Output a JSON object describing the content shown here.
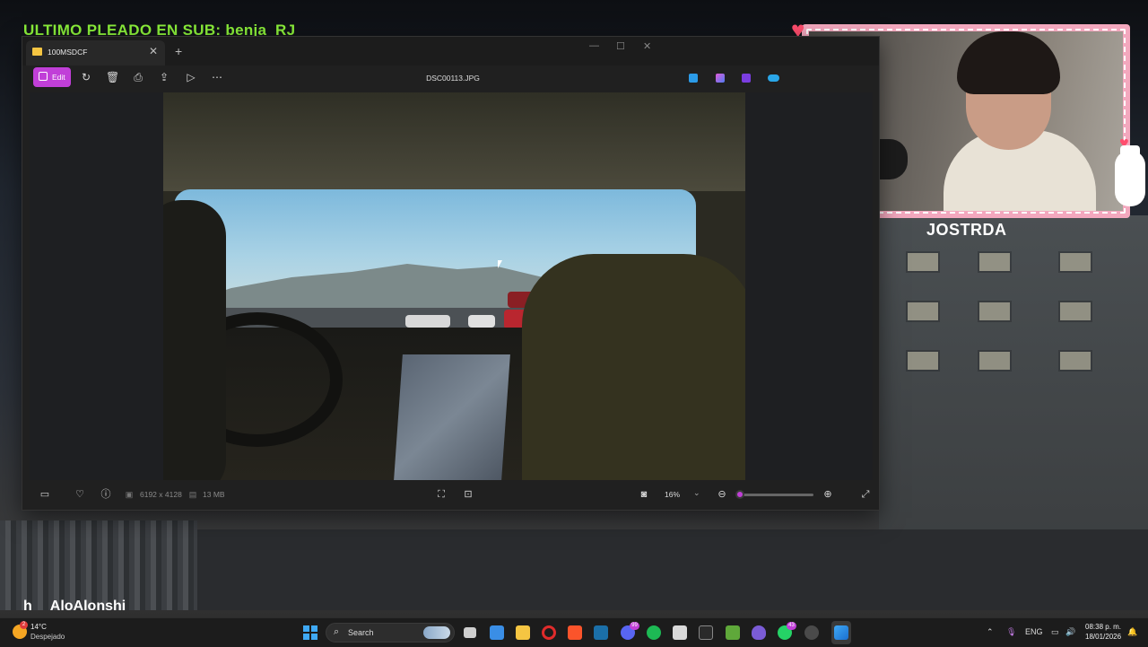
{
  "overlay": {
    "sub_banner": "ULTIMO PLEADO EN SUB: benja_RJ",
    "streamer_name": "JOSTRDA",
    "chat_prefix": "h",
    "chat_user": "AloAlonshi"
  },
  "photos_window": {
    "tab_title": "100MSDCF",
    "tab_close": "✕",
    "tab_add": "+",
    "controls": {
      "minimize": "—",
      "maximize": "☐",
      "close": "✕"
    },
    "toolbar": {
      "edit_label": "Edit",
      "icons": [
        "rotate-icon",
        "delete-icon",
        "print-icon",
        "share-icon",
        "slideshow-icon",
        "more-icon"
      ],
      "file_name": "DSC00113.JPG",
      "app_icons": [
        "designer-icon",
        "copilot-icon",
        "clipchamp-icon",
        "onedrive-icon"
      ]
    },
    "statusbar": {
      "dimensions": "6192 x 4128",
      "file_size": "13 MB",
      "zoom": "16%",
      "zoom_level": 0.0
    }
  },
  "taskbar": {
    "weather_temp": "14°C",
    "weather_desc": "Despejado",
    "weather_badge": "2",
    "search_placeholder": "Search",
    "discord_badge": "99",
    "whatsapp_badge": "43",
    "lang": "ENG",
    "time": "08:38 p. m.",
    "date": "18/01/2026"
  }
}
